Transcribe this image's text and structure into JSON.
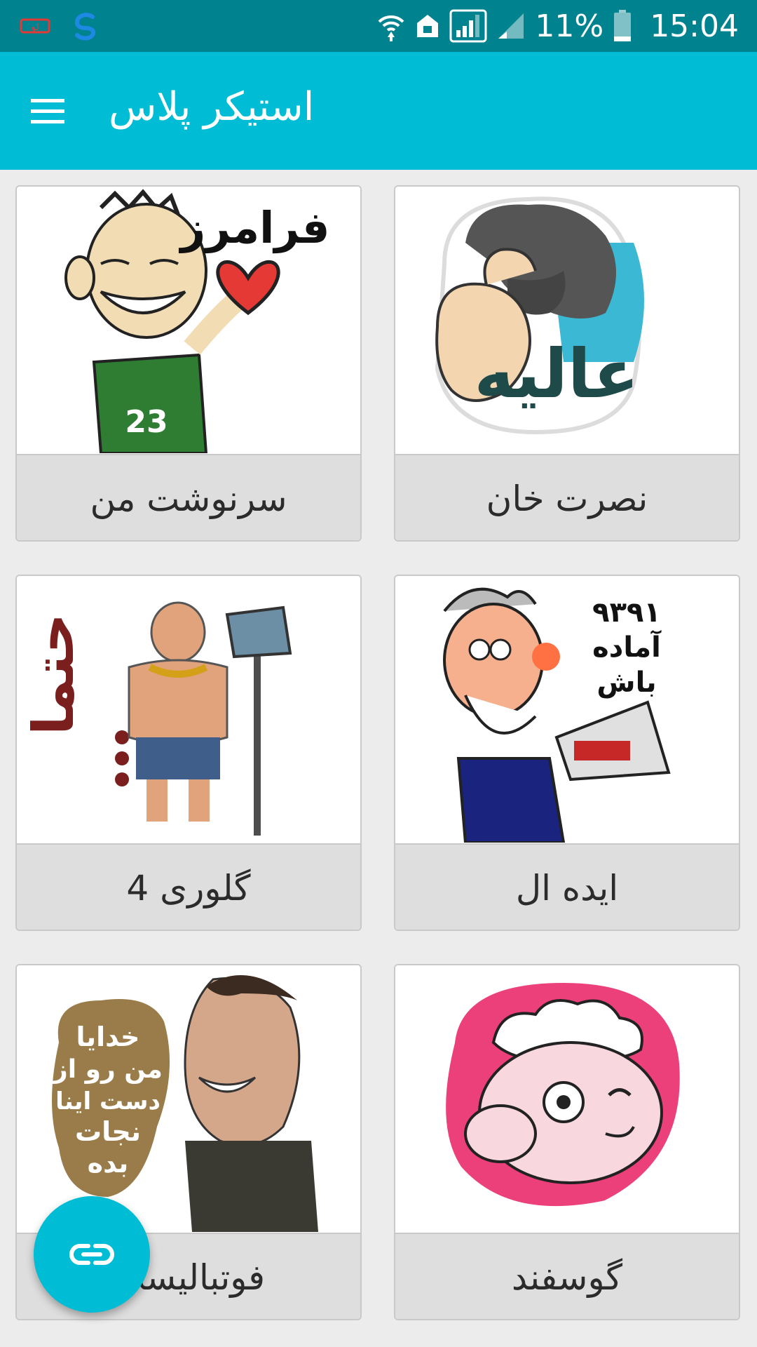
{
  "status_bar": {
    "battery": "11%",
    "time": "15:04",
    "icons": [
      "notification-icon",
      "sync-icon",
      "wifi-icon",
      "home-icon",
      "signal-icon",
      "signal-icon",
      "battery-icon"
    ]
  },
  "app_bar": {
    "title": "استیکر پلاس",
    "menu_icon": "hamburger-menu-icon",
    "color": "#00bcd4"
  },
  "packs": [
    {
      "label": "نصرت خان",
      "art": "sticker-bearded-man-alie",
      "art_text": "عالیه"
    },
    {
      "label": "سرنوشت من",
      "art": "sticker-boy-heart",
      "art_text": "فرامرز"
    },
    {
      "label": "ایده ال",
      "art": "sticker-megaphone-man",
      "art_text": "۹۳۹۱ آماده باش"
    },
    {
      "label": "گلوری 4",
      "art": "sticker-warrior-hammer",
      "art_text": "حتما..."
    },
    {
      "label": "گوسفند",
      "art": "sticker-sheep-wink",
      "art_text": ""
    },
    {
      "label": "فوتبالیست",
      "art": "sticker-footballer",
      "art_text": "خدایا من رو از دست اینا نجات بده"
    }
  ],
  "fab": {
    "icon": "link-icon",
    "color": "#00bcd4"
  }
}
